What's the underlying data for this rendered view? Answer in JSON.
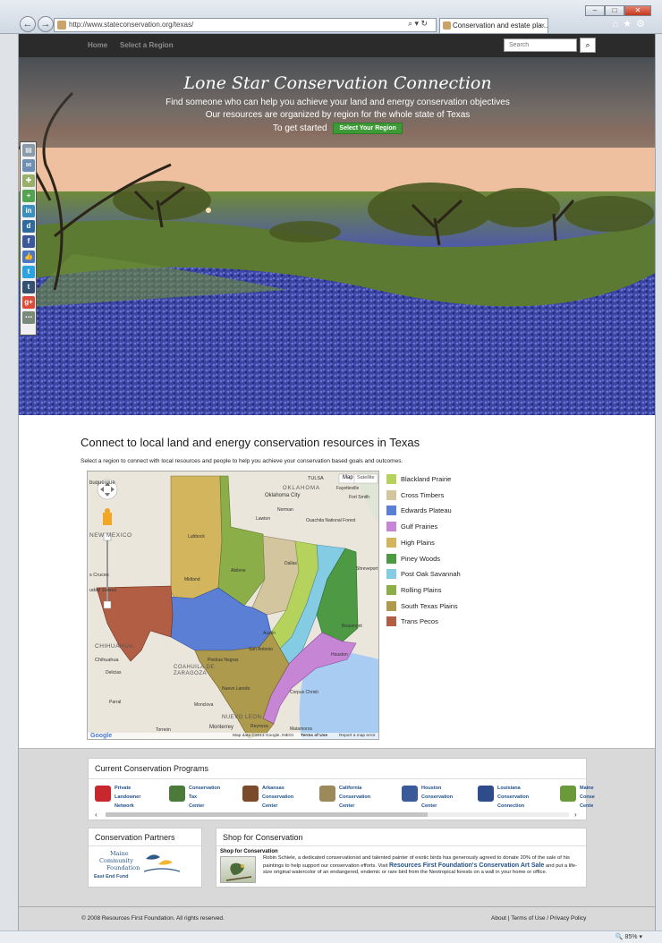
{
  "browser": {
    "url": "http://www.stateconservation.org/texas/",
    "tab_title": "Conservation and estate pla...",
    "zoom": "85%"
  },
  "nav": {
    "home": "Home",
    "select_region": "Select a Region",
    "search_placeholder": "Search"
  },
  "hero": {
    "title": "Lone Star Conservation Connection",
    "line1": "Find someone who can help you achieve your land and energy conservation objectives",
    "line2": "Our resources are organized by region for the whole state of Texas",
    "cta_prefix": "To get started",
    "cta_button": "Select Your Region"
  },
  "main": {
    "title": "Connect to local land and energy conservation resources in Texas",
    "subtitle": "Select a region to connect with local resources and people to help you achieve your conservation based goals and outcomes."
  },
  "map": {
    "map_btn": "Map",
    "satellite_btn": "Satellite",
    "footer_data": "Map data ©2013 Google, INEGI",
    "terms": "Terms of Use",
    "report": "Report a map error",
    "labels": {
      "oklahoma": "OKLAHOMA",
      "oklahoma_city": "Oklahoma City",
      "tulsa": "TULSA",
      "fayetteville": "Fayetteville",
      "fort_smith": "Fort Smith",
      "norman": "Norman",
      "lawton": "Lawton",
      "ouachita": "Ouachita National Forest",
      "albuquerque": "buquerque",
      "new_mexico": "NEW MEXICO",
      "las_cruces": "s Cruces",
      "ciudad_juarez": "udad Juárez",
      "chihuahua_state": "CHIHUAHUA",
      "chihuahua": "Chihuahua",
      "delicias": "Delicias",
      "coahuila": "COAHUILA DE ZARAGOZA",
      "nuevo_leon": "NUEVO LEON",
      "monterrey": "Monterrey",
      "reynosa": "Reynosa",
      "matamoros": "Matamoros",
      "torreon": "Torreón",
      "parral": "Parral",
      "monclova": "Monclova",
      "piedras_negras": "Piedras Negras",
      "nuevo_laredo": "Nuevo Laredo",
      "shreveport": "Shreveport",
      "beaumont": "Beaumont",
      "houston": "Houston",
      "corpus": "Corpus Christi",
      "lubbock": "Lubbock",
      "abilene": "Abilene",
      "midland": "Midland",
      "dallas": "Dallas",
      "austin": "Austin",
      "san_antonio": "San Antonio",
      "google": "Google"
    }
  },
  "legend": [
    {
      "label": "Blackland Prairie",
      "color": "#b5d35c"
    },
    {
      "label": "Cross Timbers",
      "color": "#d3c59d"
    },
    {
      "label": "Edwards Plateau",
      "color": "#5a7fd5"
    },
    {
      "label": "Gulf Prairies",
      "color": "#c785d6"
    },
    {
      "label": "High Plains",
      "color": "#d2b55c"
    },
    {
      "label": "Piney Woods",
      "color": "#4e9a44"
    },
    {
      "label": "Post Oak Savannah",
      "color": "#83cce4"
    },
    {
      "label": "Rolling Plains",
      "color": "#8cae48"
    },
    {
      "label": "South Texas Plains",
      "color": "#ad9a4c"
    },
    {
      "label": "Trans Pecos",
      "color": "#b25e45"
    }
  ],
  "programs": {
    "title": "Current Conservation Programs",
    "items": [
      {
        "line1": "Private",
        "line2": "Landowner",
        "line3": "Network",
        "color": "#c8282d"
      },
      {
        "line1": "Conservation",
        "line2": "Tax",
        "line3": "Center",
        "color": "#4b7a3a"
      },
      {
        "line1": "",
        "line2": "Arkansas",
        "line3": "Conservation",
        "line4": "Center",
        "color": "#7a4a2a"
      },
      {
        "line1": "California",
        "line2": "Conservation",
        "line3": "Center",
        "color": "#9c8a5a"
      },
      {
        "line1": "Houston",
        "line2": "Conservation",
        "line3": "Center",
        "color": "#3a5a9a"
      },
      {
        "line1": "Louisiana",
        "line2": "Conservation",
        "line3": "Connection",
        "color": "#2e4c8a"
      },
      {
        "line1": "Maine",
        "line2": "Conse",
        "line3": "Cente",
        "color": "#6a9a3a"
      }
    ]
  },
  "partners": {
    "title": "Conservation Partners",
    "logo_line1": "Maine",
    "logo_line2": "Community",
    "logo_line3": "Foundation",
    "logo_line4": "East End Fund"
  },
  "shop": {
    "title": "Shop for Conservation",
    "subtitle": "Shop for Conservation",
    "text1": "Robin Schiele, a dedicated conservationist and talented painter of exotic birds has generously agreed to donate 20% of the sale of his paintings to help support our conservation efforts.  Visit",
    "link": "Resources First Foundation's Conservation Art Sale",
    "text2": "and put a life-size original watercolor of an endangered, endemic or rare bird from the Neotropical forests on a wall in your home or office."
  },
  "footer": {
    "copyright": "© 2008 Resources First Foundation. All rights reserved.",
    "about": "About",
    "terms": "Terms of Use / Privacy Policy"
  },
  "social_icons": [
    "print-icon",
    "email-icon",
    "bookmark-icon",
    "share-icon",
    "linkedin-icon",
    "digg-icon",
    "facebook-icon",
    "like-icon",
    "twitter-icon",
    "tumblr-icon",
    "googleplus-icon",
    "more-icon"
  ]
}
